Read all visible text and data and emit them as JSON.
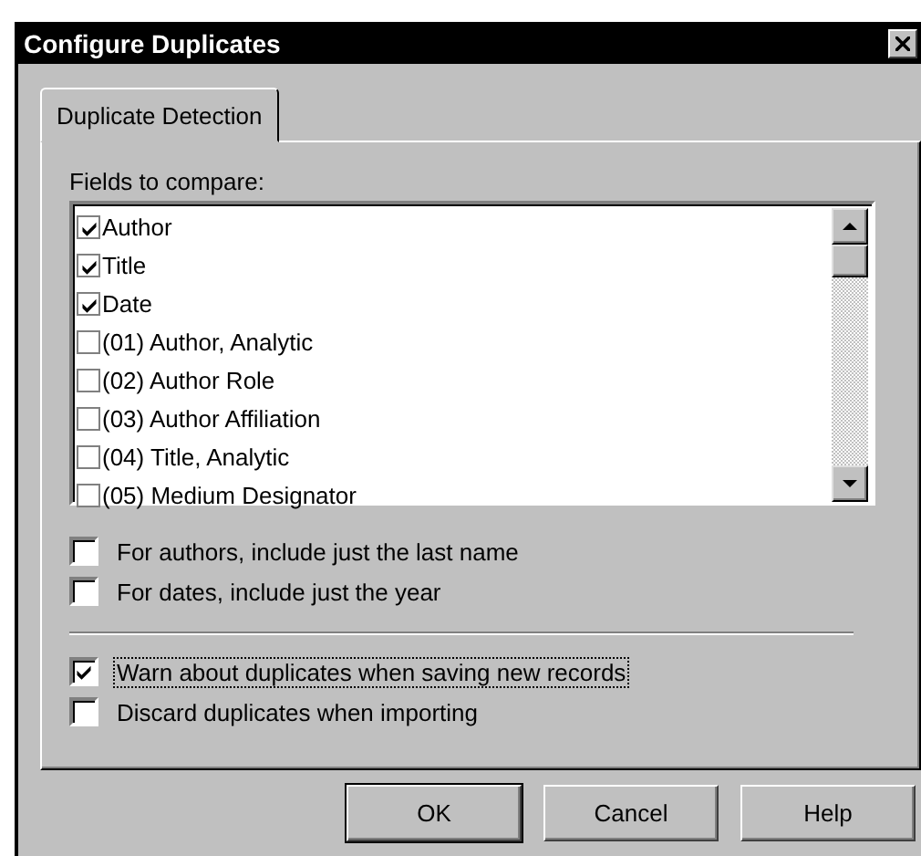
{
  "window": {
    "title": "Configure Duplicates"
  },
  "tabs": [
    {
      "label": "Duplicate Detection",
      "selected": true
    }
  ],
  "fields_label": "Fields to compare:",
  "fields": [
    {
      "label": "Author",
      "checked": true
    },
    {
      "label": "Title",
      "checked": true
    },
    {
      "label": "Date",
      "checked": true
    },
    {
      "label": "(01) Author, Analytic",
      "checked": false
    },
    {
      "label": "(02) Author Role",
      "checked": false
    },
    {
      "label": "(03) Author Affiliation",
      "checked": false
    },
    {
      "label": "(04) Title, Analytic",
      "checked": false
    },
    {
      "label": "(05) Medium Designator",
      "checked": false
    }
  ],
  "options": [
    {
      "label": "For authors, include just the last name",
      "checked": false,
      "focused": false
    },
    {
      "label": "For dates, include just the year",
      "checked": false,
      "focused": false
    }
  ],
  "import_options": [
    {
      "label": "Warn about duplicates when saving new records",
      "checked": true,
      "focused": true
    },
    {
      "label": "Discard duplicates when importing",
      "checked": false,
      "focused": false
    }
  ],
  "buttons": [
    {
      "label": "OK",
      "default": true
    },
    {
      "label": "Cancel",
      "default": false
    },
    {
      "label": "Help",
      "default": false
    }
  ]
}
